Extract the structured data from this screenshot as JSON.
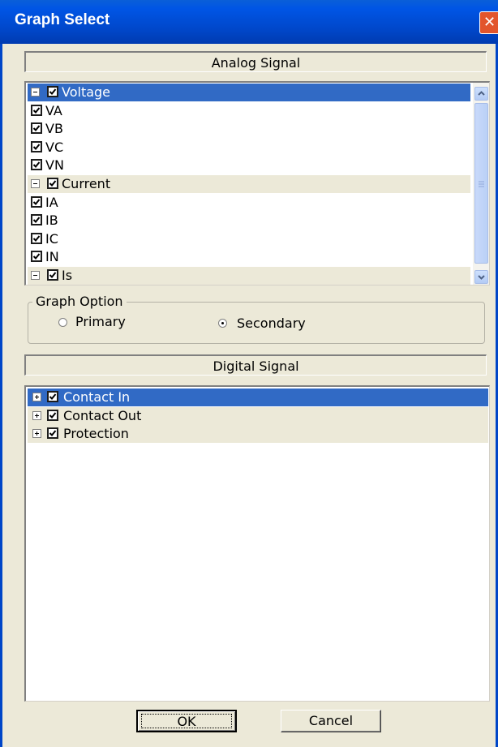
{
  "window": {
    "title": "Graph Select",
    "close_label": "✕"
  },
  "analog": {
    "header": "Analog Signal",
    "rows": [
      {
        "label": "Voltage",
        "type": "group",
        "expanded": true,
        "selected": true,
        "checked": true
      },
      {
        "label": "VA",
        "type": "item",
        "checked": true
      },
      {
        "label": "VB",
        "type": "item",
        "checked": true
      },
      {
        "label": "VC",
        "type": "item",
        "checked": true
      },
      {
        "label": "VN",
        "type": "item",
        "checked": true
      },
      {
        "label": "Current",
        "type": "group",
        "expanded": true,
        "selected": false,
        "checked": true
      },
      {
        "label": "IA",
        "type": "item",
        "checked": true
      },
      {
        "label": "IB",
        "type": "item",
        "checked": true
      },
      {
        "label": "IC",
        "type": "item",
        "checked": true
      },
      {
        "label": "IN",
        "type": "item",
        "checked": true
      },
      {
        "label": "Is",
        "type": "group",
        "expanded": true,
        "selected": false,
        "checked": true
      }
    ]
  },
  "graph_option": {
    "legend": "Graph Option",
    "primary_label": "Primary",
    "secondary_label": "Secondary",
    "selected": "Secondary"
  },
  "digital": {
    "header": "Digital Signal",
    "rows": [
      {
        "label": "Contact In",
        "expanded": false,
        "selected": true,
        "checked": true
      },
      {
        "label": "Contact Out",
        "expanded": false,
        "selected": false,
        "checked": true
      },
      {
        "label": "Protection",
        "expanded": false,
        "selected": false,
        "checked": true
      }
    ]
  },
  "buttons": {
    "ok_label": "OK",
    "cancel_label": "Cancel"
  },
  "colors": {
    "selection": "#316ac5",
    "titlebar": "#0055e5",
    "dialog_bg": "#ece9d8"
  }
}
